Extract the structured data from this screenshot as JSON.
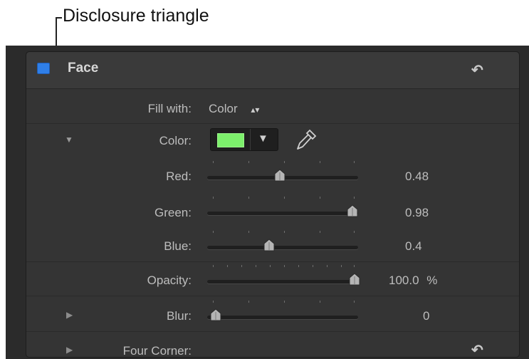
{
  "callout": {
    "label": "Disclosure triangle"
  },
  "header": {
    "title": "Face",
    "checked": true,
    "accent_color": "#2f7fe8"
  },
  "fill_with": {
    "label": "Fill with:",
    "value": "Color"
  },
  "color": {
    "label": "Color:",
    "swatch_color": "#7df06c"
  },
  "red": {
    "label": "Red:",
    "value": "0.48",
    "level": 0.48
  },
  "green": {
    "label": "Green:",
    "value": "0.98",
    "level": 0.98
  },
  "blue": {
    "label": "Blue:",
    "value": "0.4",
    "level": 0.4
  },
  "opacity": {
    "label": "Opacity:",
    "value": "100.0",
    "unit": "%",
    "level": 1.0
  },
  "blur": {
    "label": "Blur:",
    "value": "0",
    "level": 0
  },
  "four_corner": {
    "label": "Four Corner:"
  }
}
